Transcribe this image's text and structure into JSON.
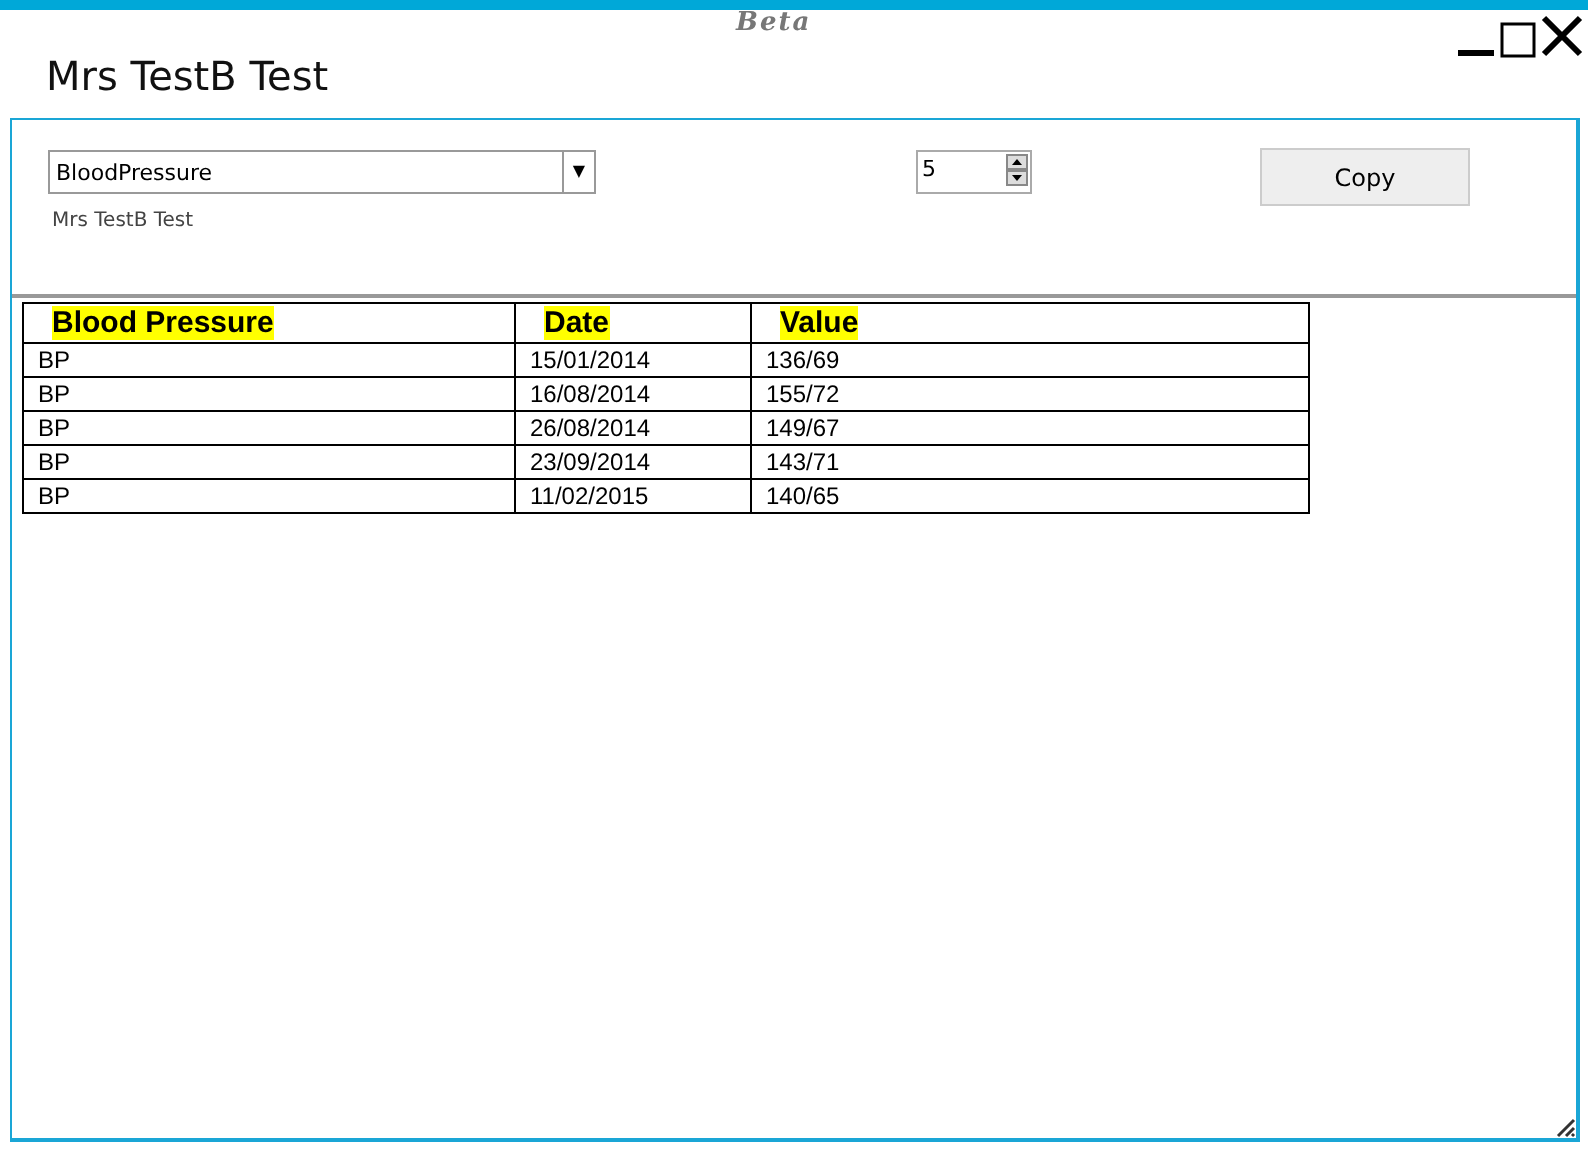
{
  "window": {
    "badge": "Beta",
    "title": "Mrs TestB Test"
  },
  "controls": {
    "dropdown": {
      "value": "BloodPressure",
      "arrow": "▼"
    },
    "patient_label": "Mrs TestB Test",
    "spinner": {
      "value": "5"
    },
    "copy_button": "Copy"
  },
  "table": {
    "columns": [
      "Blood Pressure",
      "Date",
      "Value"
    ],
    "rows": [
      [
        "BP",
        "15/01/2014",
        "136/69"
      ],
      [
        "BP",
        "16/08/2014",
        "155/72"
      ],
      [
        "BP",
        "26/08/2014",
        "149/67"
      ],
      [
        "BP",
        "23/09/2014",
        "143/71"
      ],
      [
        "BP",
        "11/02/2015",
        "140/65"
      ]
    ]
  }
}
